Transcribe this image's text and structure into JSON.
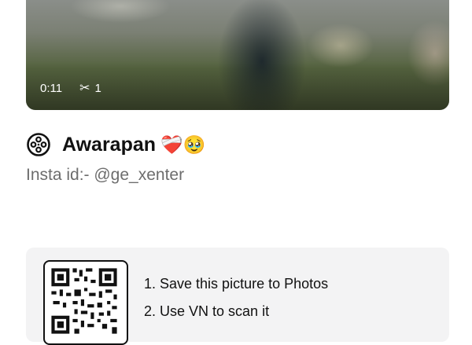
{
  "video": {
    "duration": "0:11",
    "clip_count": "1",
    "scissors_glyph": "✂"
  },
  "post": {
    "title": "Awarapan",
    "emojis": "❤️‍🩹🥹",
    "caption": "Insta id:- @ge_xenter"
  },
  "share": {
    "steps": [
      "1. Save this picture to Photos",
      "2. Use VN to scan it"
    ]
  },
  "icons": {
    "reel": "film-reel-icon",
    "scissors": "scissors-icon"
  }
}
